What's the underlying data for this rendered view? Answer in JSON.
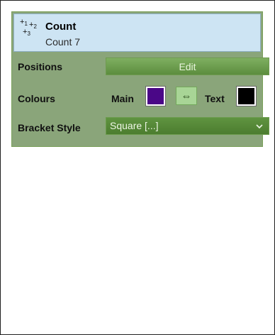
{
  "header": {
    "icon_glyphs": [
      "+1",
      "+2",
      "+3"
    ],
    "title": "Count",
    "subtitle": "Count 7"
  },
  "positions": {
    "label": "Positions",
    "edit_label": "Edit"
  },
  "colours": {
    "label": "Colours",
    "main_label": "Main",
    "main_color": "#4a0787",
    "swap_symbol": "⇔",
    "text_label": "Text",
    "text_color": "#000000"
  },
  "bracket_style": {
    "label": "Bracket Style",
    "value": "Square [...]"
  },
  "colors": {
    "panel_bg": "#8aa57a",
    "header_bg": "#cde4f3",
    "accent": "#5c8d3e"
  }
}
